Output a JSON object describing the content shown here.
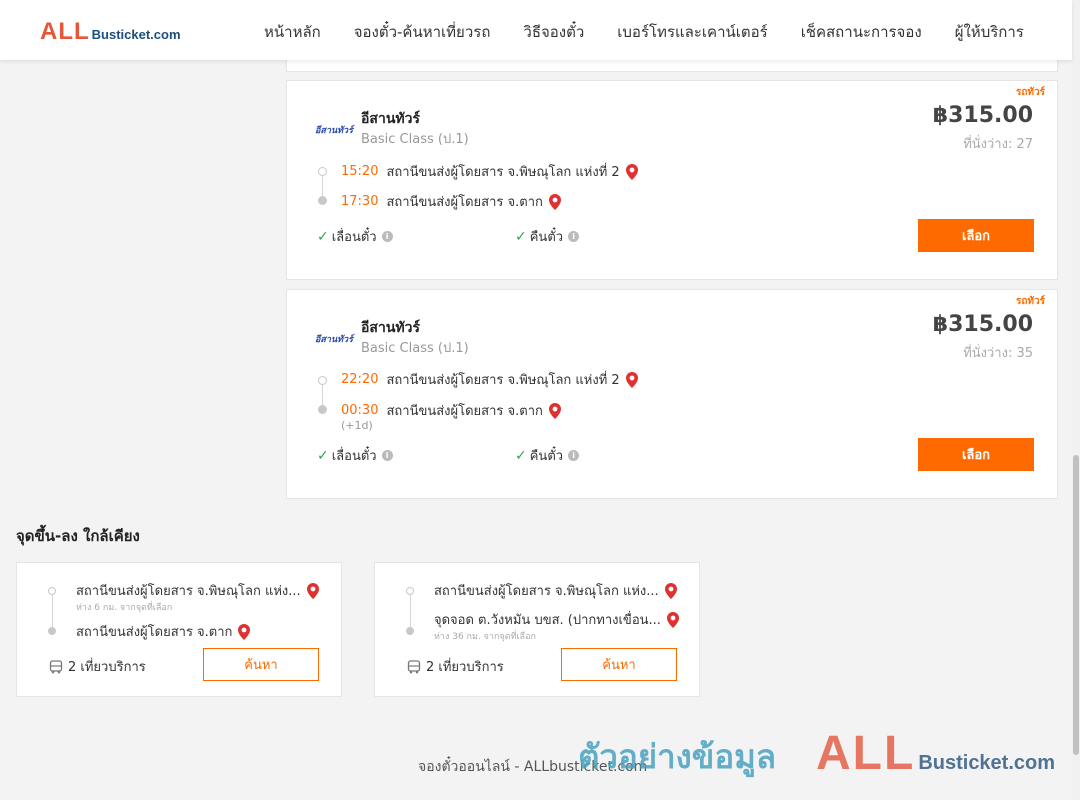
{
  "header": {
    "logo_prefix": "ALL",
    "logo_suffix": "Busticket.com",
    "nav": [
      {
        "label": "หน้าหลัก"
      },
      {
        "label": "จองตั๋ว-ค้นหาเที่ยวรถ"
      },
      {
        "label": "วิธีจองตั๋ว"
      },
      {
        "label": "เบอร์โทรและเคาน์เตอร์"
      },
      {
        "label": "เช็คสถานะการจอง"
      },
      {
        "label": "ผู้ให้บริการ"
      }
    ]
  },
  "trips": [
    {
      "tag": "รถทัวร์",
      "operator_logo": "อีสานทัวร์",
      "operator": "อีสานทัวร์",
      "class": "Basic Class (ป.1)",
      "price": "฿315.00",
      "seats": "ที่นั่งว่าง: 27",
      "depart_time": "15:20",
      "depart_station": "สถานีขนส่งผู้โดยสาร จ.พิษณุโลก แห่งที่ 2",
      "arrive_time": "17:30",
      "arrive_station": "สถานีขนส่งผู้โดยสาร จ.ตาก",
      "next_day": "",
      "feature_change": "เลื่อนตั๋ว",
      "feature_refund": "คืนตั๋ว",
      "select_label": "เลือก"
    },
    {
      "tag": "รถทัวร์",
      "operator_logo": "อีสานทัวร์",
      "operator": "อีสานทัวร์",
      "class": "Basic Class (ป.1)",
      "price": "฿315.00",
      "seats": "ที่นั่งว่าง: 35",
      "depart_time": "22:20",
      "depart_station": "สถานีขนส่งผู้โดยสาร จ.พิษณุโลก แห่งที่ 2",
      "arrive_time": "00:30",
      "arrive_station": "สถานีขนส่งผู้โดยสาร จ.ตาก",
      "next_day": "(+1d)",
      "feature_change": "เลื่อนตั๋ว",
      "feature_refund": "คืนตั๋ว",
      "select_label": "เลือก"
    }
  ],
  "nearby": {
    "title": "จุดขึ้น-ลง ใกล้เคียง",
    "cards": [
      {
        "from": "สถานีขนส่งผู้โดยสาร จ.พิษณุโลก แห่ง...",
        "from_dist": "ห่าง 6 กม. จากจุดที่เลือก",
        "to": "สถานีขนส่งผู้โดยสาร จ.ตาก",
        "to_dist": "",
        "trips": "2 เที่ยวบริการ",
        "search_label": "ค้นหา"
      },
      {
        "from": "สถานีขนส่งผู้โดยสาร จ.พิษณุโลก แห่ง...",
        "from_dist": "",
        "to": "จุดจอด ต.วังหมัน บขส. (ปากทางเขื่อน...",
        "to_dist": "ห่าง 36 กม. จากจุดที่เลือก",
        "trips": "2 เที่ยวบริการ",
        "search_label": "ค้นหา"
      }
    ]
  },
  "footer": {
    "text": "จองตั๋วออนไลน์ - ALLbusticket.com"
  },
  "watermark": {
    "text": "ตัวอย่างข้อมูล",
    "logo_prefix": "ALL",
    "logo_suffix": "Busticket.com"
  },
  "colors": {
    "accent": "#ff6a00",
    "brand_red": "#e8563a",
    "brand_blue": "#1f4e79",
    "check_green": "#2ea44f",
    "pin_red": "#e03030"
  }
}
